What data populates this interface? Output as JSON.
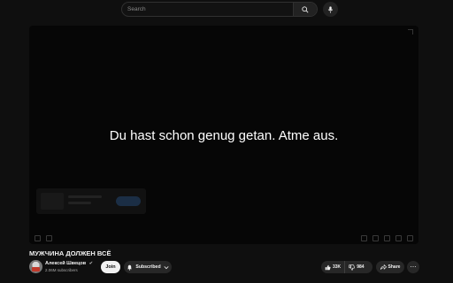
{
  "search": {
    "placeholder": "Search",
    "search_icon": "search-icon",
    "mic_icon": "microphone-icon"
  },
  "player": {
    "subtitle": "Du hast schon genug getan. Atme aus."
  },
  "video": {
    "title": "МУЖЧИНА ДОЛЖЕН ВСЁ"
  },
  "channel": {
    "name": "Алексей Швецов",
    "verified_icon": "verified-icon",
    "subscribers": "2.06M subscribers",
    "join_label": "Join",
    "subscribed_label": "Subscribed"
  },
  "actions": {
    "like_count": "33K",
    "dislike_count": "984",
    "share_label": "Share",
    "more_label": "⋯"
  },
  "colors": {
    "background": "#0f0f0f",
    "button_bg": "#272727",
    "join_bg": "#f1f1f1"
  }
}
